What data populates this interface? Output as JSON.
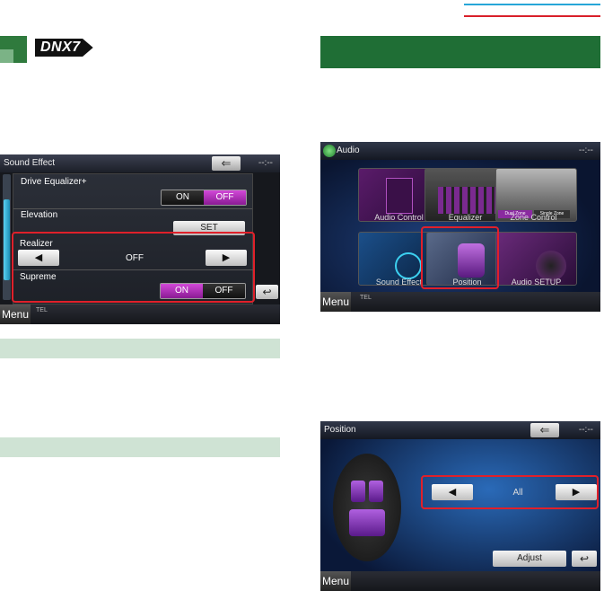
{
  "badge": {
    "model": "DNX7"
  },
  "sound_effect": {
    "title": "Sound Effect",
    "clock": "--:--",
    "drive_eq_label": "Drive Equalizer+",
    "drive_eq_on": "ON",
    "drive_eq_off": "OFF",
    "elevation_label": "Elevation",
    "elevation_button": "SET",
    "realizer_label": "Realizer",
    "realizer_value": "OFF",
    "supreme_label": "Supreme",
    "supreme_on": "ON",
    "supreme_off": "OFF",
    "menu": "Menu",
    "tel": "TEL",
    "back_glyph": "⇐",
    "return_glyph": "↩"
  },
  "audio": {
    "title": "Audio",
    "clock": "--:--",
    "tiles": [
      {
        "label": "Audio Control"
      },
      {
        "label": "Equalizer"
      },
      {
        "label": "Zone Control"
      },
      {
        "label": "Sound Effect"
      },
      {
        "label": "Position"
      },
      {
        "label": "Audio SETUP"
      }
    ],
    "zone_tabs": [
      "Dual Zone",
      "Single Zone"
    ],
    "menu": "Menu",
    "tel": "TEL"
  },
  "position": {
    "title": "Position",
    "clock": "--:--",
    "value": "All",
    "adjust": "Adjust",
    "menu": "Menu",
    "back_glyph": "⇐",
    "return_glyph": "↩"
  },
  "icons": {
    "left": "◀",
    "right": "▶"
  },
  "colors": {
    "accent_green": "#1f6e35",
    "toggle_on": "#b52fbf",
    "highlight_red": "#e0202a",
    "rule_blue": "#27a6d8",
    "rule_red": "#d9202a"
  }
}
